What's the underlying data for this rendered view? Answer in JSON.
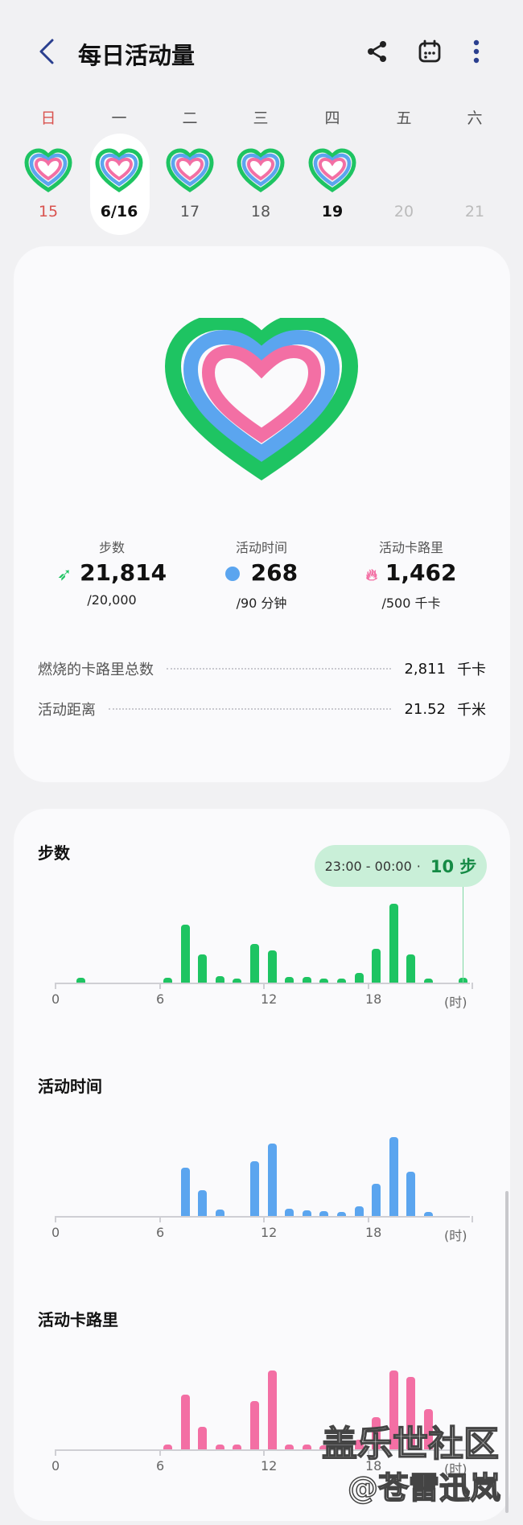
{
  "header": {
    "title": "每日活动量",
    "back_icon": "back-arrow-icon",
    "share_icon": "share-icon",
    "calendar_icon": "calendar-icon",
    "more_icon": "more-vertical-icon"
  },
  "week": {
    "weekdays": [
      "日",
      "一",
      "二",
      "三",
      "四",
      "五",
      "六"
    ],
    "days": [
      "15",
      "6/16",
      "17",
      "18",
      "19",
      "20",
      "21"
    ]
  },
  "summary": {
    "steps": {
      "label": "步数",
      "value": "21,814",
      "goal": "/20,000"
    },
    "active_time": {
      "label": "活动时间",
      "value": "268",
      "goal": "/90 分钟"
    },
    "active_calories": {
      "label": "活动卡路里",
      "value": "1,462",
      "goal": "/500 千卡"
    },
    "total_calories": {
      "label": "燃烧的卡路里总数",
      "value": "2,811",
      "unit": "千卡"
    },
    "distance": {
      "label": "活动距离",
      "value": "21.52",
      "unit": "千米"
    }
  },
  "charts": {
    "axis_labels": [
      "0",
      "6",
      "12",
      "18",
      "(时)"
    ],
    "tooltip": {
      "time": "23:00 - 00:00",
      "separator": "·",
      "value": "10 步"
    },
    "steps_title": "步数",
    "time_title": "活动时间",
    "cal_title": "活动卡路里"
  },
  "chart_data": [
    {
      "type": "bar",
      "title": "步数",
      "xlabel": "(时)",
      "categories": [
        "0",
        "1",
        "2",
        "3",
        "4",
        "5",
        "6",
        "7",
        "8",
        "9",
        "10",
        "11",
        "12",
        "13",
        "14",
        "15",
        "16",
        "17",
        "18",
        "19",
        "20",
        "21",
        "22",
        "23"
      ],
      "values": [
        0,
        6,
        0,
        0,
        0,
        0,
        6,
        72,
        35,
        8,
        5,
        48,
        40,
        7,
        7,
        5,
        5,
        12,
        42,
        98,
        35,
        5,
        0,
        6
      ],
      "color": "#1ec462"
    },
    {
      "type": "bar",
      "title": "活动时间",
      "xlabel": "(时)",
      "categories": [
        "0",
        "1",
        "2",
        "3",
        "4",
        "5",
        "6",
        "7",
        "8",
        "9",
        "10",
        "11",
        "12",
        "13",
        "14",
        "15",
        "16",
        "17",
        "18",
        "19",
        "20",
        "21",
        "22",
        "23"
      ],
      "values": [
        0,
        0,
        0,
        0,
        0,
        0,
        0,
        60,
        32,
        8,
        0,
        68,
        90,
        9,
        7,
        6,
        5,
        12,
        40,
        98,
        55,
        5,
        0,
        0
      ],
      "color": "#5ba5ef"
    },
    {
      "type": "bar",
      "title": "活动卡路里",
      "xlabel": "(时)",
      "categories": [
        "0",
        "1",
        "2",
        "3",
        "4",
        "5",
        "6",
        "7",
        "8",
        "9",
        "10",
        "11",
        "12",
        "13",
        "14",
        "15",
        "16",
        "17",
        "18",
        "19",
        "20",
        "21",
        "22",
        "23"
      ],
      "values": [
        0,
        0,
        0,
        0,
        0,
        0,
        6,
        68,
        28,
        6,
        6,
        60,
        98,
        6,
        6,
        5,
        5,
        12,
        40,
        98,
        90,
        50,
        0,
        0
      ],
      "color": "#f36fa4"
    }
  ],
  "watermark": {
    "line1": "盖乐世社区",
    "line2": "@苍雷迅岚"
  },
  "colors": {
    "steps": "#1ec462",
    "time": "#5ba5ef",
    "calories": "#f36fa4",
    "sunday": "#d9534f",
    "selected_bg": "#ffffff"
  }
}
